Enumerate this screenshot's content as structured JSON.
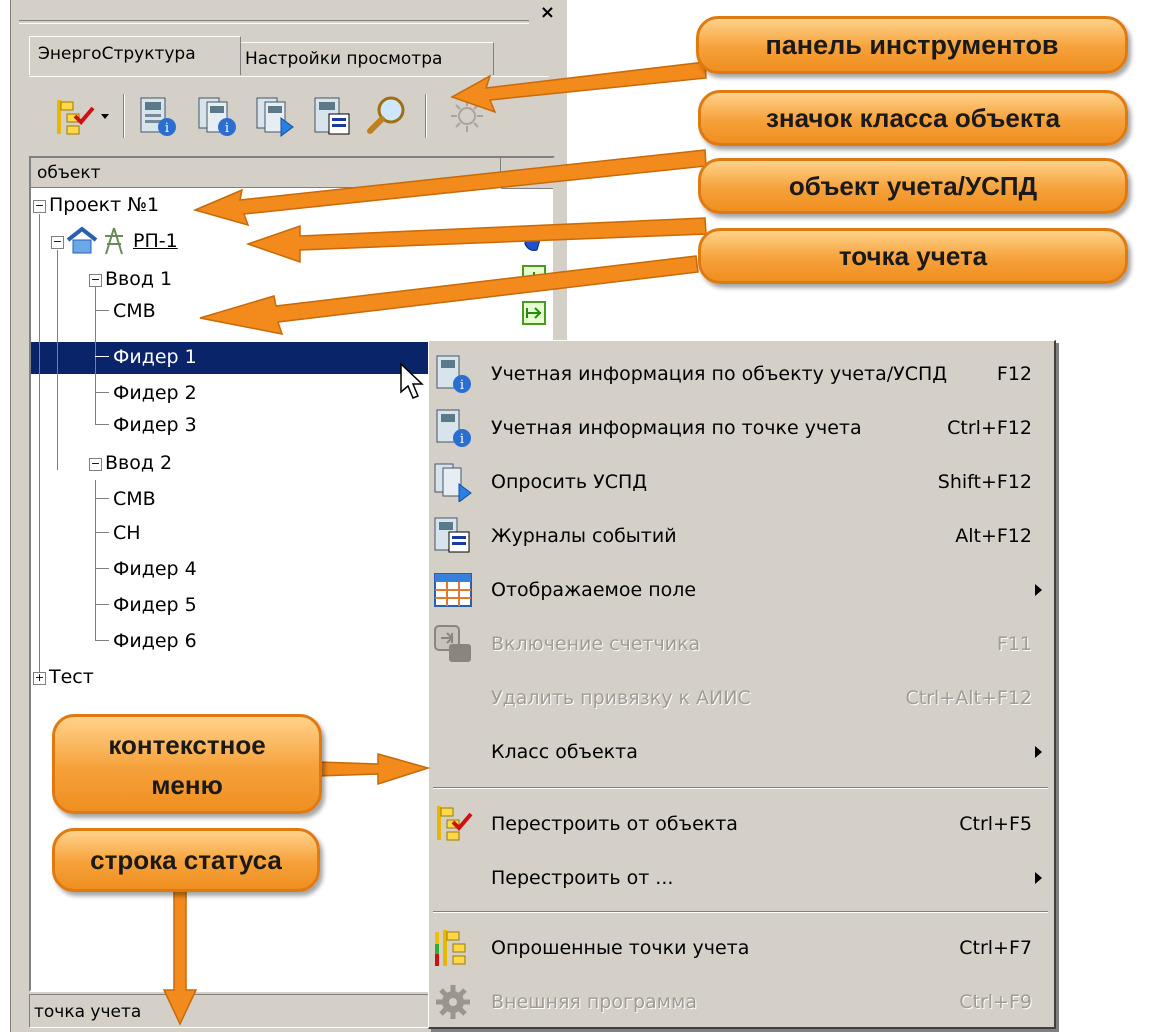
{
  "panel": {
    "close_label": "×",
    "tabs": [
      "ЭнергоСтруктура",
      "Настройки просмотра"
    ],
    "column_header": "объект",
    "status_text": "точка учета"
  },
  "tree": {
    "nodes": [
      "Проект №1",
      "РП-1",
      "Ввод 1",
      "СМВ",
      "Фидер 1",
      "Фидер 2",
      "Фидер 3",
      "Ввод 2",
      "СМВ",
      "СН",
      "Фидер 4",
      "Фидер 5",
      "Фидер 6",
      "Тест"
    ],
    "selected": "Фидер 1"
  },
  "context_menu": {
    "items": [
      {
        "label": "Учетная информация по объекту учета/УСПД",
        "shortcut": "F12",
        "enabled": true,
        "icon": "meter-info-icon"
      },
      {
        "label": "Учетная информация по точке учета",
        "shortcut": "Ctrl+F12",
        "enabled": true,
        "icon": "point-info-icon"
      },
      {
        "label": "Опросить УСПД",
        "shortcut": "Shift+F12",
        "enabled": true,
        "icon": "poll-icon"
      },
      {
        "label": "Журналы событий",
        "shortcut": "Alt+F12",
        "enabled": true,
        "icon": "event-log-icon"
      },
      {
        "label": "Отображаемое поле",
        "shortcut": "",
        "enabled": true,
        "icon": "table-icon",
        "submenu": true
      },
      {
        "label": "Включение счетчика",
        "shortcut": "F11",
        "enabled": false,
        "icon": "meter-on-icon"
      },
      {
        "label": "Удалить привязку к АИИС",
        "shortcut": "Ctrl+Alt+F12",
        "enabled": false
      },
      {
        "label": "Класс объекта",
        "shortcut": "",
        "enabled": true,
        "submenu": true
      },
      {
        "label": "Перестроить от объекта",
        "shortcut": "Ctrl+F5",
        "enabled": true,
        "icon": "rebuild-tree-icon"
      },
      {
        "label": "Перестроить от ...",
        "shortcut": "",
        "enabled": true,
        "submenu": true
      },
      {
        "label": "Опрошенные точки учета",
        "shortcut": "Ctrl+F7",
        "enabled": true,
        "icon": "polled-points-icon"
      },
      {
        "label": "Внешняя программа",
        "shortcut": "Ctrl+F9",
        "enabled": false,
        "icon": "gear-icon"
      }
    ]
  },
  "callouts": {
    "toolbar": "панель инструментов",
    "class_icon": "значок класса объекта",
    "object": "объект учета/УСПД",
    "point": "точка учета",
    "context_menu_line1": "контекстное",
    "context_menu_line2": "меню",
    "status_bar": "строка статуса"
  },
  "colors": {
    "selection": "#0a246a",
    "callout_orange": "#f6a13a",
    "arrow_orange": "#f28a1c",
    "panel_gray": "#d4d0c8"
  }
}
